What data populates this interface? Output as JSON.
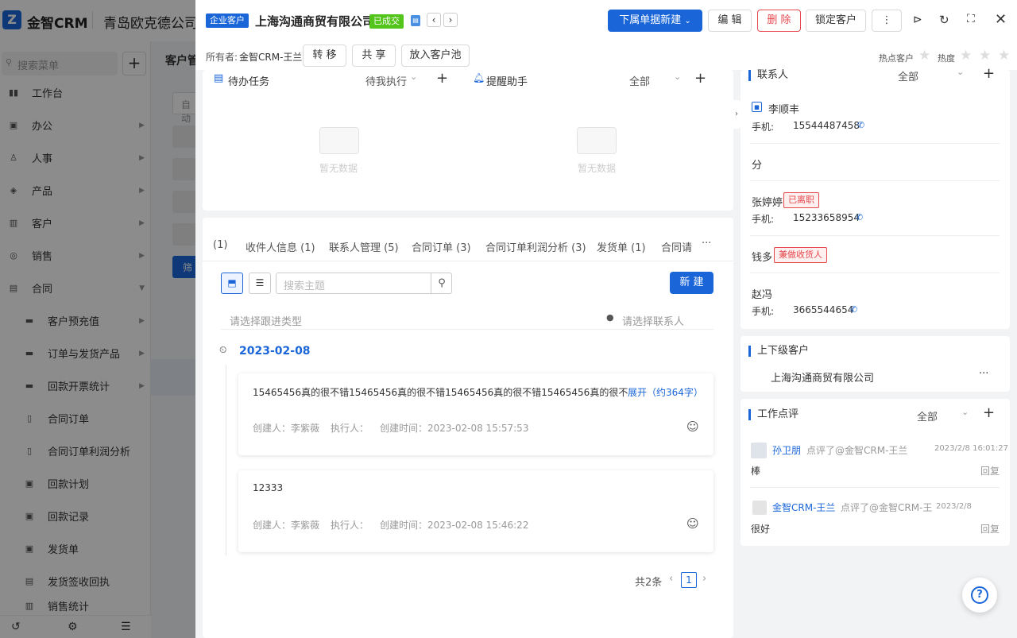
{
  "app": {
    "name": "金智CRM",
    "company": "青岛欧克德公司",
    "logo_char": "Z"
  },
  "nav": {
    "search_placeholder": "搜索菜单",
    "add": "+",
    "items": [
      {
        "label": "工作台",
        "icon": "▮▮"
      },
      {
        "label": "办公",
        "icon": "▣"
      },
      {
        "label": "人事",
        "icon": "♙"
      },
      {
        "label": "产品",
        "icon": "◈"
      },
      {
        "label": "客户",
        "icon": "▥"
      },
      {
        "label": "销售",
        "icon": "◎"
      },
      {
        "label": "合同",
        "icon": "▤"
      }
    ],
    "subitems": [
      "客户预充值",
      "订单与发货产品",
      "回款开票统计",
      "合同订单",
      "合同订单利润分析",
      "回款计划",
      "回款记录",
      "发货单",
      "发货签收回执",
      "销售统计"
    ],
    "bg_header": "客户管",
    "bg_tag": "自动",
    "bg_btn": "筛"
  },
  "drawer": {
    "type_tag": "企业客户",
    "title": "上海沟通商贸有限公司",
    "status_tag": "已成交",
    "owner_label": "所有者:",
    "owner": "金智CRM-王兰",
    "btn_transfer": "转 移",
    "btn_share": "共 享",
    "btn_pool": "放入客户池",
    "btn_new": "下属单据新建",
    "btn_edit": "编 辑",
    "btn_delete": "删 除",
    "btn_lock": "锁定客户",
    "btn_more": "⋮",
    "hot_label": "热点客户",
    "heat_label": "热度"
  },
  "tasks": {
    "title": "待办任务",
    "filter": "待我执行",
    "empty": "暂无数据"
  },
  "reminder": {
    "title": "提醒助手",
    "filter": "全部",
    "empty": "暂无数据"
  },
  "tabs": [
    "(1)",
    "收件人信息 (1)",
    "联系人管理 (5)",
    "合同订单 (3)",
    "合同订单利润分析 (3)",
    "发货单 (1)",
    "合同请"
  ],
  "tabs_more": "···",
  "followup": {
    "search_placeholder": "搜索主题",
    "new_btn": "新 建",
    "type_placeholder": "请选择跟进类型",
    "contact_placeholder": "请选择联系人",
    "date": "2023-02-08",
    "records": [
      {
        "content": "15465456真的很不错15465456真的很不错15465456真的很不错15465456真的很不错1...",
        "expand": "展开（约364字）",
        "creator": "创建人：李紫薇",
        "executor": "执行人：",
        "time": "创建时间：2023-02-08 15:57:53"
      },
      {
        "content": "12333",
        "expand": "",
        "creator": "创建人：李紫薇",
        "executor": "执行人：",
        "time": "创建时间：2023-02-08 15:46:22"
      }
    ],
    "total": "共2条",
    "page": "1"
  },
  "contacts": {
    "title": "联系人",
    "filter": "全部",
    "phone_label": "手机:",
    "items": [
      {
        "name": "李顺丰",
        "tag": "",
        "phone": "15544487458"
      },
      {
        "name": "分",
        "tag": "",
        "phone": ""
      },
      {
        "name": "张婷婷",
        "tag": "已离职",
        "phone": "15233658954"
      },
      {
        "name": "钱多",
        "tag": "兼做收货人",
        "phone": ""
      },
      {
        "name": "赵冯",
        "tag": "",
        "phone": "3665544654"
      }
    ]
  },
  "parent": {
    "title": "上下级客户",
    "name": "上海沟通商贸有限公司",
    "more": "···"
  },
  "reviews": {
    "title": "工作点评",
    "filter": "全部",
    "reply": "回复",
    "items": [
      {
        "user": "孙卫朋",
        "action": "点评了@金智CRM-王兰",
        "time": "2023/2/8 16:01:27",
        "text": "棒"
      },
      {
        "user": "金智CRM-王兰",
        "action": "点评了@金智CRM-王",
        "time": "2023/2/8",
        "text": "很好"
      }
    ]
  },
  "colors": {
    "primary": "#1a66d9",
    "danger": "#e5484d",
    "success": "#52c41a"
  }
}
